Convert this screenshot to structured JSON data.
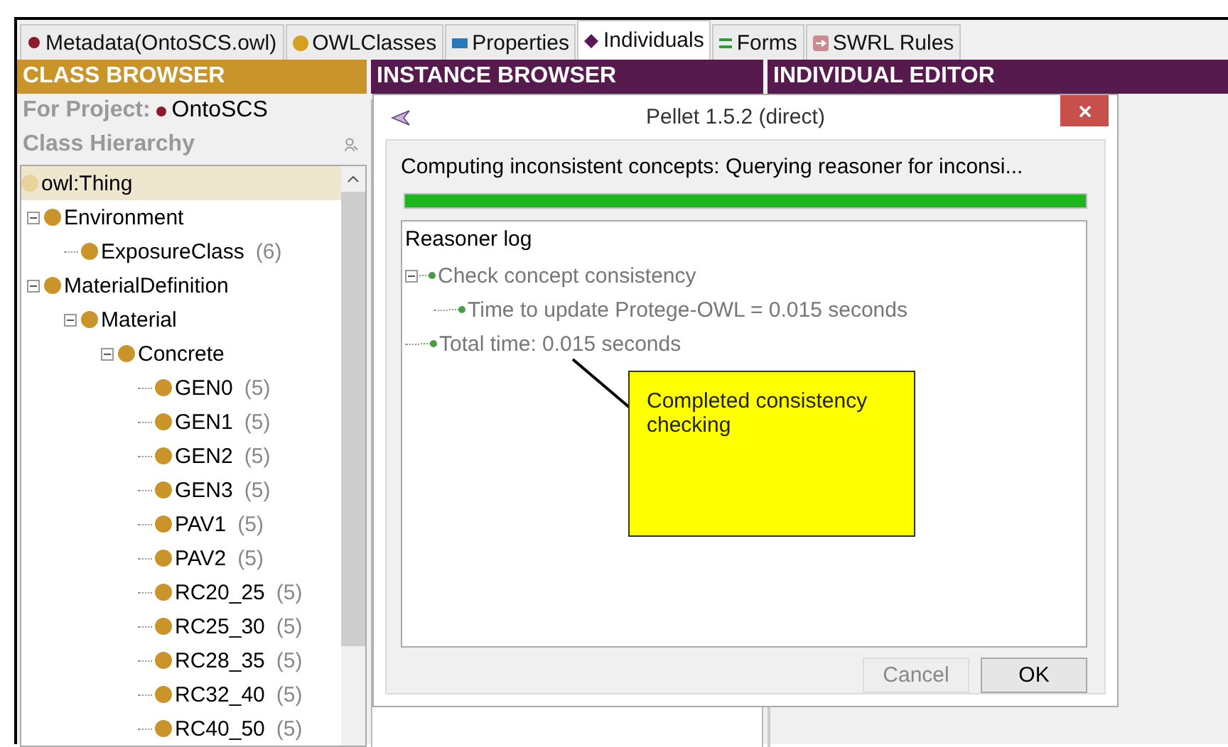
{
  "tabs": [
    {
      "label": "Metadata(OntoSCS.owl)",
      "kind": "metadata",
      "selected": false
    },
    {
      "label": "OWLClasses",
      "kind": "classes",
      "selected": false
    },
    {
      "label": "Properties",
      "kind": "properties",
      "selected": false
    },
    {
      "label": "Individuals",
      "kind": "individuals",
      "selected": true
    },
    {
      "label": "Forms",
      "kind": "forms",
      "selected": false
    },
    {
      "label": "SWRL Rules",
      "kind": "swrl",
      "selected": false
    }
  ],
  "class_browser": {
    "title": "CLASS BROWSER",
    "project_label": "For Project:",
    "project_name": "OntoSCS",
    "hierarchy_label": "Class Hierarchy",
    "tree": [
      {
        "name": "owl:Thing",
        "selected": true,
        "children": [
          {
            "name": "Environment",
            "selected": false,
            "expanded": true,
            "children": [
              {
                "name": "ExposureClass",
                "count": "(6)",
                "selected": false
              }
            ]
          },
          {
            "name": "MaterialDefinition",
            "selected": false,
            "expanded": true,
            "children": [
              {
                "name": "Material",
                "selected": false,
                "expanded": true,
                "children": [
                  {
                    "name": "Concrete",
                    "selected": false,
                    "expanded": true,
                    "children": [
                      {
                        "name": "GEN0",
                        "count": "(5)",
                        "selected": false
                      },
                      {
                        "name": "GEN1",
                        "count": "(5)",
                        "selected": false
                      },
                      {
                        "name": "GEN2",
                        "count": "(5)",
                        "selected": false
                      },
                      {
                        "name": "GEN3",
                        "count": "(5)",
                        "selected": false
                      },
                      {
                        "name": "PAV1",
                        "count": "(5)",
                        "selected": false
                      },
                      {
                        "name": "PAV2",
                        "count": "(5)",
                        "selected": false
                      },
                      {
                        "name": "RC20_25",
                        "count": "(5)",
                        "selected": false
                      },
                      {
                        "name": "RC25_30",
                        "count": "(5)",
                        "selected": false
                      },
                      {
                        "name": "RC28_35",
                        "count": "(5)",
                        "selected": false
                      },
                      {
                        "name": "RC32_40",
                        "count": "(5)",
                        "selected": false
                      },
                      {
                        "name": "RC40_50",
                        "count": "(5)",
                        "selected": false
                      }
                    ]
                  }
                ]
              }
            ]
          }
        ]
      }
    ]
  },
  "instance_browser": {
    "title": "INSTANCE BROWSER"
  },
  "individual_editor": {
    "title": "INDIVIDUAL EDITOR"
  },
  "dialog": {
    "title": "Pellet 1.5.2 (direct)",
    "status": "Computing inconsistent concepts: Querying reasoner for inconsi...",
    "progress": {
      "level": 1.0
    },
    "log_title": "Reasoner log",
    "log": [
      {
        "text": "Check concept consistency",
        "expanded": true,
        "children": [
          {
            "text": "Time to update Protege-OWL = 0.015 seconds"
          }
        ]
      },
      {
        "text": "Total time: 0.015 seconds"
      }
    ],
    "callout": "Completed consistency checking",
    "buttons": [
      {
        "label": "Cancel",
        "disabled": true
      },
      {
        "label": "OK",
        "disabled": false
      }
    ]
  }
}
